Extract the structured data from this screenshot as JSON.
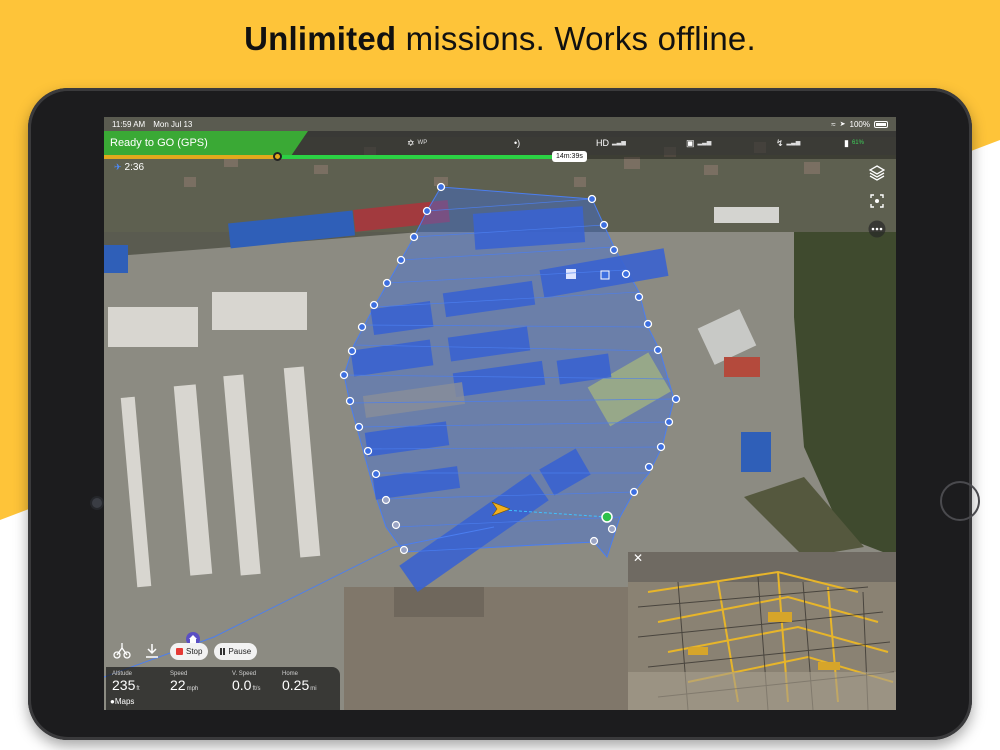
{
  "headline": {
    "bold": "Unlimited",
    "rest": "missions. Works offline."
  },
  "status_bar": {
    "time": "11:59 AM",
    "date": "Mon Jul 13",
    "battery": "100%"
  },
  "top_bar": {
    "status": "Ready to GO (GPS)",
    "waypoint_label": "WP",
    "video_label": "HD",
    "drone_battery": "61%"
  },
  "progress": {
    "time_remaining": "14m:39s",
    "fraction_complete": 0.22
  },
  "flight_time": "2:36",
  "actions": {
    "stop_label": "Stop",
    "pause_label": "Pause"
  },
  "telemetry": {
    "altitude": {
      "label": "Altitude",
      "value": "235",
      "unit": "ft"
    },
    "speed": {
      "label": "Speed",
      "value": "22",
      "unit": "mph"
    },
    "vspeed": {
      "label": "V. Speed",
      "value": "0.0",
      "unit": "ft/s"
    },
    "home": {
      "label": "Home",
      "value": "0.25",
      "unit": "mi"
    }
  },
  "map_credit": "Maps",
  "colors": {
    "brand_yellow": "#fec439",
    "ready_green": "#3aa935",
    "mission_blue": "#3d6fe0",
    "drone_arrow": "#f2b01e"
  },
  "icons": [
    "wifi-icon",
    "location-icon",
    "drone-icon",
    "antenna-icon",
    "remote-icon",
    "satellite-icon",
    "battery-icon",
    "layers-icon",
    "focus-icon",
    "more-icon",
    "home-icon",
    "download-icon",
    "close-icon",
    "drone-arrow-icon"
  ]
}
